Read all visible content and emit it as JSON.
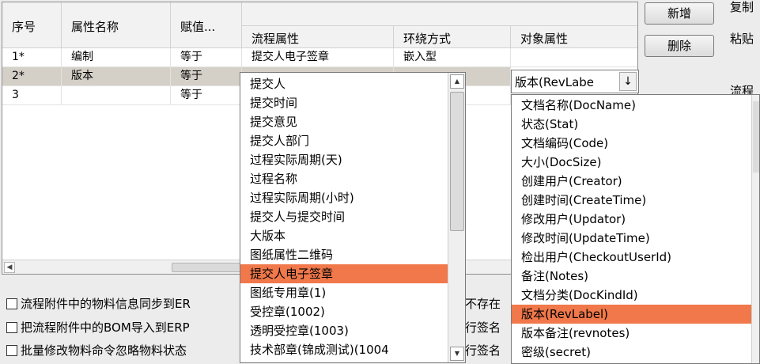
{
  "grid": {
    "headers": {
      "seq": "序号",
      "attr_name": "属性名称",
      "assign": "赋值...",
      "flow_attr": "流程属性",
      "env": "环绕方式",
      "obj_attr": "对象属性"
    },
    "rows": [
      {
        "seq": "1*",
        "attr_name": "编制",
        "assign": "等于",
        "flow_attr": "提交人电子签章",
        "env": "嵌入型",
        "obj_attr": ""
      },
      {
        "seq": "2*",
        "attr_name": "版本",
        "assign": "等于",
        "flow_attr": "",
        "env": "",
        "obj_attr": "版本(RevLabe"
      },
      {
        "seq": "3",
        "attr_name": "",
        "assign": "等于",
        "flow_attr": "",
        "env": "",
        "obj_attr": ""
      }
    ]
  },
  "buttons": {
    "add": "新增",
    "delete": "删除"
  },
  "side_labels": [
    "复制",
    "粘贴",
    "流程"
  ],
  "checkboxes": [
    {
      "label": "流程附件中的物料信息同步到ER",
      "checked": false
    },
    {
      "label": "把流程附件中的BOM导入到ERP",
      "checked": false
    },
    {
      "label": "批量修改物料命令忽略物料状态",
      "checked": false
    }
  ],
  "partial_texts": [
    "不存在",
    "行签名",
    "行签名"
  ],
  "flow_dropdown": {
    "items": [
      "提交人",
      "提交时间",
      "提交意见",
      "提交人部门",
      "过程实际周期(天)",
      "过程名称",
      "过程实际周期(小时)",
      "提交人与提交时间",
      "大版本",
      "图纸属性二维码",
      "提交人电子签章",
      "图纸专用章(1)",
      "受控章(1002)",
      "透明受控章(1003)",
      "技术部章(锦成测试)(1004"
    ],
    "highlighted": "提交人电子签章"
  },
  "object_combo": {
    "value": "版本(RevLabe",
    "arrow": "↓"
  },
  "object_dropdown": {
    "items": [
      "文档名称(DocName)",
      "状态(Stat)",
      "文档编码(Code)",
      "大小(DocSize)",
      "创建用户(Creator)",
      "创建时间(CreateTime)",
      "修改用户(Updator)",
      "修改时间(UpdateTime)",
      "检出用户(CheckoutUserId)",
      "备注(Notes)",
      "文档分类(DocKindId)",
      "版本(RevLabel)",
      "版本备注(revnotes)",
      "密级(secret)"
    ],
    "highlighted": "版本(RevLabel)"
  },
  "colors": {
    "highlight": "#f0784a",
    "selected_row": "#d4d0c8"
  },
  "icons": {
    "scroll_up": "▲",
    "scroll_down": "▼",
    "scroll_left": "◀"
  }
}
